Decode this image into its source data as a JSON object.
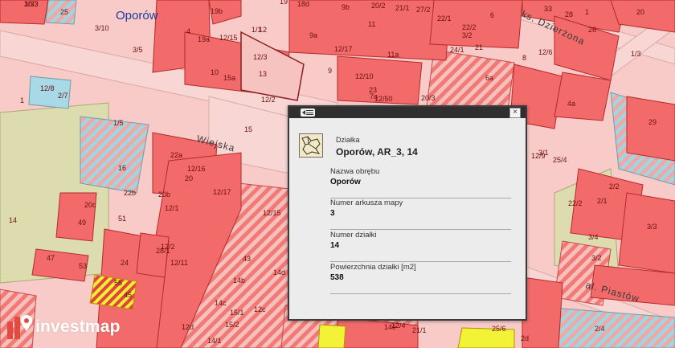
{
  "map": {
    "district_label": "Oporów",
    "streets": [
      "Wiejska",
      "ks. Dzierżona",
      "al. Piastów"
    ],
    "parcel_numbers": [
      "3/33",
      "25",
      "3/10",
      "19b",
      "18d",
      "9b",
      "20/2",
      "21/1",
      "27/2",
      "33",
      "28",
      "1",
      "20",
      "3/5",
      "4",
      "19a",
      "12/15",
      "1/1",
      "12",
      "9a",
      "11",
      "22/1",
      "22/2",
      "6",
      "26",
      "3/2",
      "19",
      "12/3",
      "12/17",
      "11a",
      "21",
      "8",
      "1/3",
      "12/8",
      "2/7",
      "15a",
      "10",
      "13",
      "12/10",
      "24/1",
      "12/6",
      "9",
      "6a",
      "23",
      "7a",
      "12/2",
      "15",
      "1",
      "1/5",
      "22a",
      "12/16",
      "20",
      "12/17",
      "16",
      "22b",
      "20b",
      "12/1",
      "20c",
      "49",
      "51",
      "12/15",
      "14",
      "24",
      "12/2",
      "47",
      "53",
      "55",
      "45",
      "43",
      "14b",
      "14c",
      "14d",
      "12c",
      "12d",
      "14/1",
      "15/2",
      "15/1",
      "14e",
      "28/1",
      "12/11",
      "29",
      "22/2",
      "2/2",
      "2/1",
      "3/4",
      "3/1",
      "3/2",
      "3/3",
      "12/50",
      "20/3",
      "12/4",
      "21/1",
      "12/9",
      "4a",
      "25/4",
      "25/6",
      "2d",
      "2/4",
      "10/3"
    ],
    "colors": {
      "parcel_fill": "#f26a6a",
      "parcel_line": "#b52a2a",
      "hatch_light": "#f6b9b4",
      "hatch_blue": "#a9dbe3",
      "road": "#f7cfcc",
      "green_area": "#dfe0b3",
      "yellow_parcel": "#f2f236"
    }
  },
  "popup": {
    "feature_type": "Działka",
    "title": "Oporów, AR_3, 14",
    "attributes": [
      {
        "label": "Nazwa obrębu",
        "value": "Oporów"
      },
      {
        "label": "Numer arkusza mapy",
        "value": "3"
      },
      {
        "label": "Numer działki",
        "value": "14"
      },
      {
        "label": "Powierzchnia działki [m2]",
        "value": "538"
      }
    ],
    "close_label": "×"
  },
  "branding": {
    "logo_text": "investmap"
  }
}
